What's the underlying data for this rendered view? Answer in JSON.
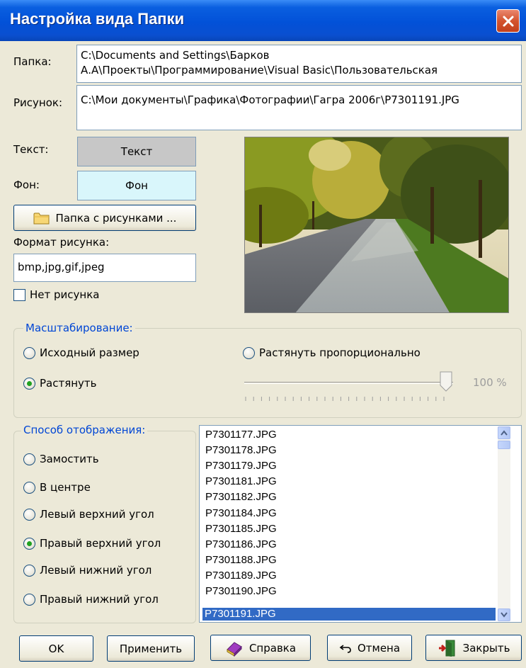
{
  "window": {
    "title": "Настройка вида Папки"
  },
  "fields": {
    "folder_label": "Папка:",
    "folder_line1": "C:\\Documents and Settings\\Барков",
    "folder_line2": "А.А\\Проекты\\Программирование\\Visual Basic\\Пользовательская",
    "picture_label": "Рисунок:",
    "picture_value": "C:\\Мои документы\\Графика\\Фотографии\\Гагра 2006г\\P7301191.JPG"
  },
  "colors": {
    "text_label": "Текст:",
    "text_button": "Текст",
    "text_swatch": "#c7c7c7",
    "bg_label": "Фон:",
    "bg_button": "Фон",
    "bg_swatch": "#d9f6fb"
  },
  "folder_button": {
    "label": "Папка с рисунками ...",
    "icon": "folder-icon"
  },
  "format": {
    "label": "Формат рисунка:",
    "value": "bmp,jpg,gif,jpeg"
  },
  "no_picture": {
    "label": "Нет рисунка",
    "checked": false
  },
  "scaling": {
    "title": "Масштабирование:",
    "options": [
      {
        "label": "Исходный размер",
        "selected": false
      },
      {
        "label": "Растянуть пропорционально",
        "selected": false
      },
      {
        "label": "Растянуть",
        "selected": true
      }
    ],
    "slider_value": 100,
    "slider_text": "100 %"
  },
  "display_mode": {
    "title": "Способ отображения:",
    "options": [
      {
        "label": "Замостить",
        "selected": false
      },
      {
        "label": "В центре",
        "selected": false
      },
      {
        "label": "Левый верхний угол",
        "selected": false
      },
      {
        "label": "Правый верхний угол",
        "selected": true
      },
      {
        "label": "Левый нижний угол",
        "selected": false
      },
      {
        "label": "Правый нижний угол",
        "selected": false
      }
    ]
  },
  "file_list": {
    "items": [
      "P7301177.JPG",
      "P7301178.JPG",
      "P7301179.JPG",
      "P7301181.JPG",
      "P7301182.JPG",
      "P7301184.JPG",
      "P7301185.JPG",
      "P7301186.JPG",
      "P7301188.JPG",
      "P7301189.JPG",
      "P7301190.JPG",
      "P7301191.JPG"
    ],
    "selected": "P7301191.JPG"
  },
  "buttons": {
    "ok": "OK",
    "apply": "Применить",
    "help": "Справка",
    "cancel": "Отмена",
    "close": "Закрыть"
  }
}
